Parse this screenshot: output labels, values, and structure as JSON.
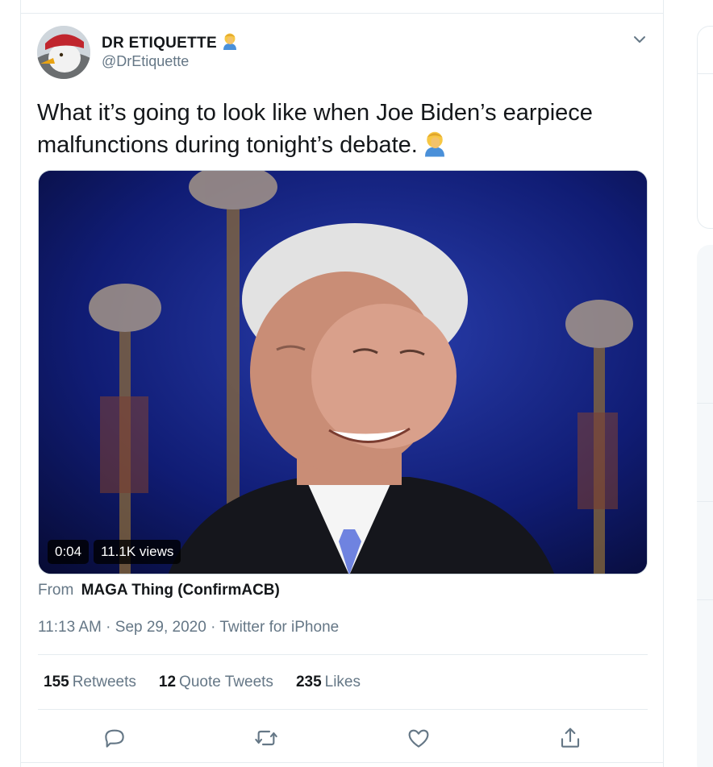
{
  "tweet": {
    "display_name": "DR ETIQUETTE",
    "handle": "@DrEtiquette",
    "text": "What it’s going to look like when Joe Biden’s earpiece malfunctions during tonight’s debate.",
    "media": {
      "duration": "0:04",
      "views": "11.1K views"
    },
    "source_label": "From",
    "source_name": "MAGA Thing (ConfirmACB)",
    "time": "11:13 AM",
    "separator": "·",
    "date": "Sep 29, 2020",
    "client": "Twitter for iPhone",
    "stats": {
      "retweets_count": "155",
      "retweets_label": "Retweets",
      "quotes_count": "12",
      "quotes_label": "Quote Tweets",
      "likes_count": "235",
      "likes_label": "Likes"
    },
    "actions": [
      "reply-icon",
      "retweet-icon",
      "like-icon",
      "share-icon"
    ],
    "emoji_name": "man-facepalming-emoji"
  },
  "colors": {
    "text_primary": "#14171a",
    "text_secondary": "#657786",
    "divider": "#e6ecf0",
    "icon": "#657786"
  }
}
